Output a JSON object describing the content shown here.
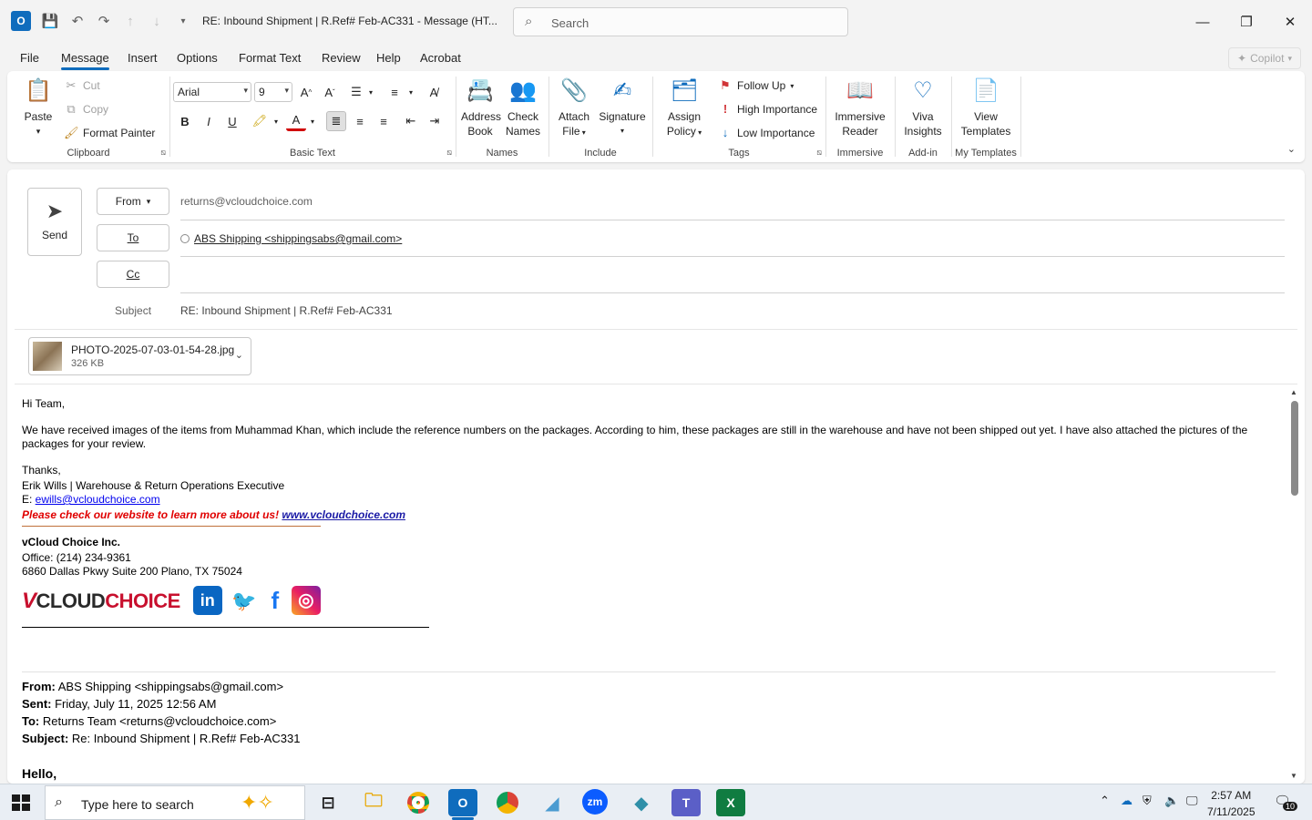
{
  "window": {
    "title": "RE: Inbound Shipment | R.Ref# Feb-AC331  -  Message (HT...",
    "search_placeholder": "Search",
    "app_logo": "O"
  },
  "menu": {
    "tabs": [
      "File",
      "Message",
      "Insert",
      "Options",
      "Format Text",
      "Review",
      "Help",
      "Acrobat"
    ],
    "active": "Message",
    "copilot": "Copilot"
  },
  "ribbon": {
    "clipboard": {
      "label": "Clipboard",
      "paste": "Paste",
      "cut": "Cut",
      "copy": "Copy",
      "format_painter": "Format Painter"
    },
    "basic_text": {
      "label": "Basic Text",
      "font": "Arial",
      "size": "9"
    },
    "names": {
      "label": "Names",
      "address_book_1": "Address",
      "address_book_2": "Book",
      "check_names_1": "Check",
      "check_names_2": "Names"
    },
    "include": {
      "label": "Include",
      "attach_1": "Attach",
      "attach_2": "File",
      "signature": "Signature"
    },
    "tags": {
      "label": "Tags",
      "assign_1": "Assign",
      "assign_2": "Policy",
      "follow_up": "Follow Up",
      "high": "High Importance",
      "low": "Low Importance"
    },
    "immersive": {
      "label": "Immersive",
      "reader_1": "Immersive",
      "reader_2": "Reader"
    },
    "addin": {
      "label": "Add-in",
      "viva_1": "Viva",
      "viva_2": "Insights"
    },
    "templates": {
      "label": "My Templates",
      "view_1": "View",
      "view_2": "Templates"
    }
  },
  "compose": {
    "send": "Send",
    "from_label": "From",
    "from_value": "returns@vcloudchoice.com",
    "to_label": "To",
    "to_value": "ABS Shipping <shippingsabs@gmail.com>",
    "cc_label": "Cc",
    "subject_label": "Subject",
    "subject_value": "RE: Inbound Shipment | R.Ref# Feb-AC331",
    "attachment": {
      "name": "PHOTO-2025-07-03-01-54-28.jpg",
      "size": "326 KB"
    }
  },
  "body": {
    "greeting": "Hi Team,",
    "paragraph": "We have received images of the items from Muhammad Khan, which include the reference numbers on the packages. According to him, these packages are still in the warehouse and have not been shipped out yet. I have also attached the pictures of the packages for your review.",
    "thanks": "Thanks,",
    "signer": "Erik Wills | Warehouse & Return Operations Executive",
    "email_prefix": "E: ",
    "email": "ewills@vcloudchoice.com",
    "promo_text": "Please check our website to learn more about us! ",
    "promo_link": "www.vcloudchoice.com",
    "company": "vCloud Choice Inc.",
    "office": "Office: (214) 234-9361",
    "address": "6860 Dallas Pkwy Suite 200 Plano, TX 75024",
    "logo_v": "V",
    "logo_cloud": "CLOUD",
    "logo_choice": "CHOICE",
    "social": {
      "linkedin": "in",
      "twitter": "🐦",
      "facebook": "f",
      "instagram": "◎"
    }
  },
  "quoted": {
    "from_label": "From:",
    "from_value": " ABS Shipping <shippingsabs@gmail.com>",
    "sent_label": "Sent:",
    "sent_value": " Friday, July 11, 2025 12:56 AM",
    "to_label": "To:",
    "to_value": " Returns Team <returns@vcloudchoice.com>",
    "subject_label": "Subject:",
    "subject_value": " Re: Inbound Shipment | R.Ref# Feb-AC331",
    "hello": "Hello,"
  },
  "taskbar": {
    "search_placeholder": "Type here to search",
    "time": "2:57 AM",
    "date": "7/11/2025",
    "notifications": "10",
    "apps": {
      "zoom": "zm",
      "excel": "X",
      "teams": "T"
    }
  }
}
